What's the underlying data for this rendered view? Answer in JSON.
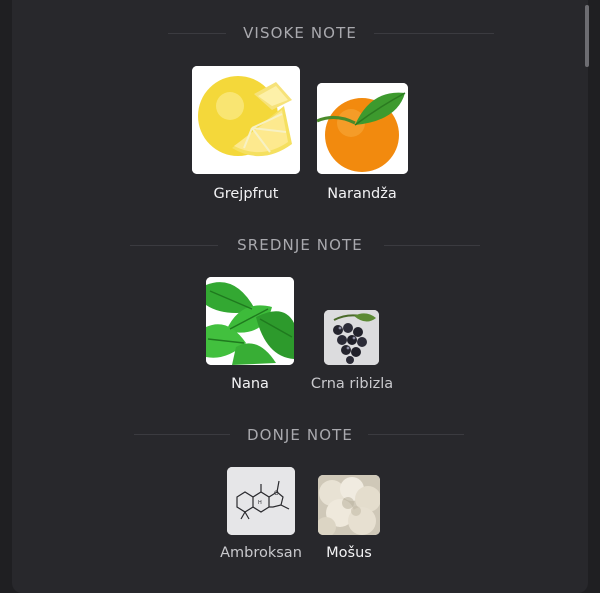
{
  "sections": [
    {
      "title": "VISOKE NOTE",
      "notes": [
        {
          "name": "Grejpfrut",
          "icon": "grapefruit-icon"
        },
        {
          "name": "Narandža",
          "icon": "orange-icon"
        }
      ]
    },
    {
      "title": "SREDNJE NOTE",
      "notes": [
        {
          "name": "Nana",
          "icon": "mint-icon"
        },
        {
          "name": "Crna ribizla",
          "icon": "blackcurrant-icon"
        }
      ]
    },
    {
      "title": "DONJE NOTE",
      "notes": [
        {
          "name": "Ambroksan",
          "icon": "ambroxan-molecule-icon"
        },
        {
          "name": "Mošus",
          "icon": "musk-icon"
        }
      ]
    }
  ]
}
